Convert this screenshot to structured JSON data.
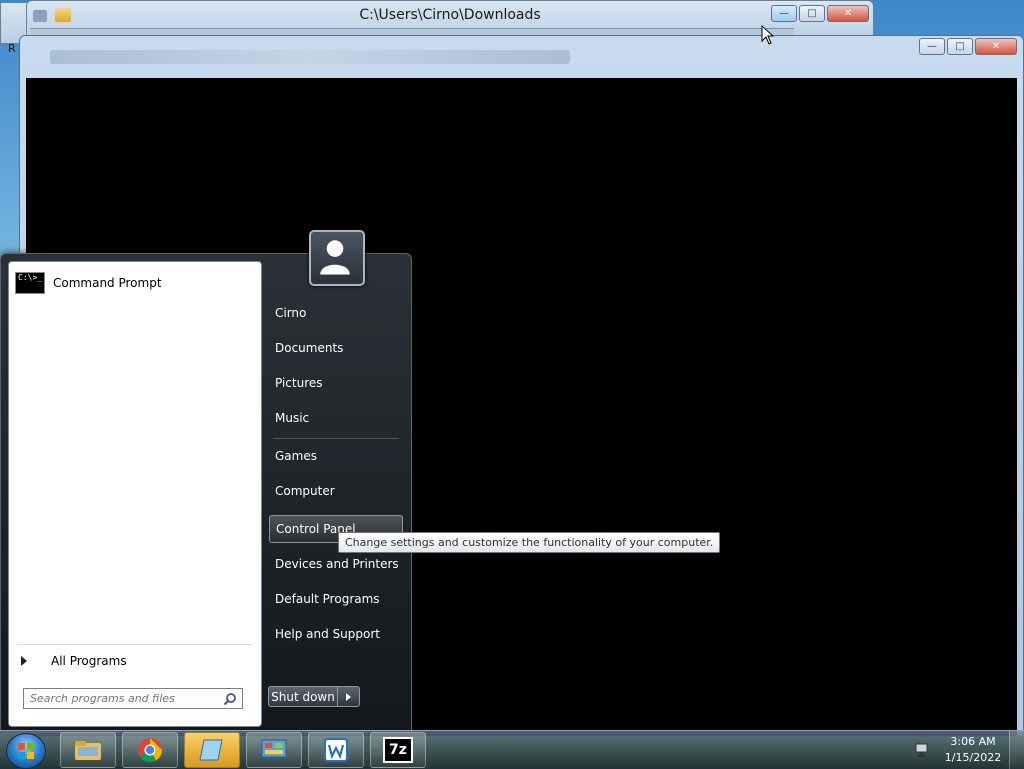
{
  "background_window": {
    "title": "C:\\Users\\Cirno\\Downloads",
    "partial_label": "R"
  },
  "main_window": {},
  "start_menu": {
    "pinned_programs": [
      {
        "label": "Command Prompt",
        "icon": "command-prompt-icon"
      }
    ],
    "cmd_icon_text": "C:\\>_",
    "all_programs_label": "All Programs",
    "search_placeholder": "Search programs and files",
    "right_items": [
      {
        "label": "Cirno"
      },
      {
        "label": "Documents"
      },
      {
        "label": "Pictures"
      },
      {
        "label": "Music"
      },
      {
        "label": "Games"
      },
      {
        "label": "Computer"
      },
      {
        "label": "Control Panel",
        "hover": true
      },
      {
        "label": "Devices and Printers"
      },
      {
        "label": "Default Programs"
      },
      {
        "label": "Help and Support"
      }
    ],
    "shutdown_label": "Shut down",
    "tooltip": "Change settings and customize the functionality of your computer."
  },
  "taskbar": {
    "pinned": [
      {
        "name": "windows-explorer",
        "icon": "folder-icon"
      },
      {
        "name": "google-chrome",
        "icon": "chrome-icon"
      },
      {
        "name": "notepad",
        "icon": "notepad-icon",
        "active": true
      },
      {
        "name": "control-panel",
        "icon": "control-panel-icon"
      },
      {
        "name": "wps-writer",
        "icon": "wps-writer-icon"
      },
      {
        "name": "7-zip",
        "icon": "sevenzip-icon",
        "text": "7z"
      }
    ],
    "clock_time": "3:06 AM",
    "clock_date": "1/15/2022"
  },
  "colors": {
    "start_menu_bg": "#1b1f24",
    "tooltip_bg": "#ffffff",
    "taskbar_active": "#e8b43c"
  }
}
